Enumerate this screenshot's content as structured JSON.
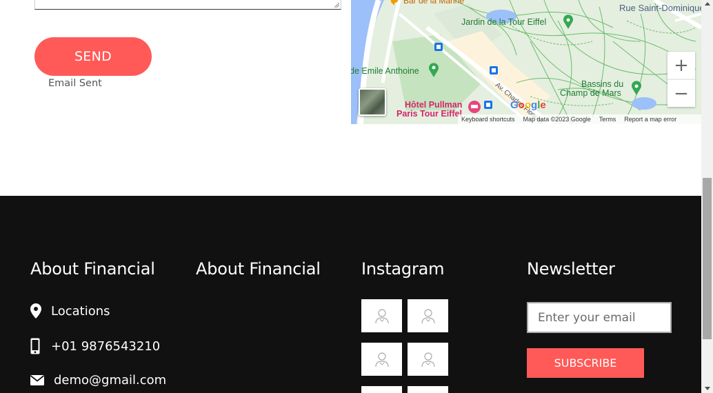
{
  "contact_form": {
    "send_label": "SEND",
    "status_text": "Email Sent"
  },
  "map": {
    "labels": {
      "bar_marine": "Bar de la Marine",
      "rue_dominique": "Rue Saint-Dominique",
      "jardin": "Jardin de la Tour Eiffel",
      "emile": "de Emile Anthoine",
      "av_charles": "Av. Charles Floquet",
      "bassins": "Bassins du",
      "champ": "Champ de Mars",
      "hotel1": "Hôtel Pullman",
      "hotel2": "Paris Tour Eiffel"
    },
    "zoom_in_label": "+",
    "zoom_out_label": "−",
    "google_logo": "Google",
    "attribution": {
      "shortcuts": "Keyboard shortcuts",
      "map_data": "Map data ©2023 Google",
      "terms": "Terms",
      "report": "Report a map error"
    }
  },
  "footer": {
    "columns": [
      {
        "title": "About Financial"
      },
      {
        "title": "About Financial"
      },
      {
        "title": "Instagram"
      },
      {
        "title": "Newsletter"
      }
    ],
    "contact": {
      "location": "Locations",
      "phone": "+01 9876543210",
      "email": "demo@gmail.com"
    },
    "newsletter": {
      "placeholder": "Enter your email",
      "subscribe_label": "SUBSCRIBE"
    }
  },
  "colors": {
    "accent": "#ff5a57",
    "footer_bg": "#111111",
    "map_green": "#34a853"
  }
}
